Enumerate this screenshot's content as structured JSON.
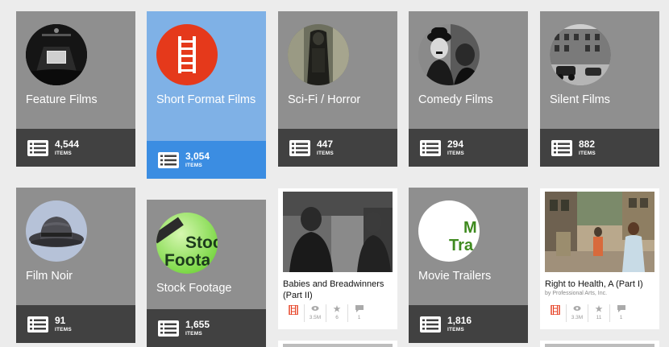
{
  "collections": [
    {
      "title": "Feature Films",
      "count": "4,544",
      "unit": "ITEMS"
    },
    {
      "title": "Short Format Films",
      "count": "3,054",
      "unit": "ITEMS"
    },
    {
      "title": "Sci-Fi / Horror",
      "count": "447",
      "unit": "ITEMS"
    },
    {
      "title": "Comedy Films",
      "count": "294",
      "unit": "ITEMS"
    },
    {
      "title": "Silent Films",
      "count": "882",
      "unit": "ITEMS"
    },
    {
      "title": "Film Noir",
      "count": "91",
      "unit": "ITEMS"
    },
    {
      "title": "Stock Footage",
      "count": "1,655",
      "unit": "ITEMS",
      "logo_top": "Stoc",
      "logo_bottom": "Foota"
    },
    {
      "title": "Movie Trailers",
      "count": "1,816",
      "unit": "ITEMS",
      "logo_top": "M",
      "logo_bottom": "Tra"
    }
  ],
  "items": [
    {
      "title": "Babies and Breadwinners (Part II)",
      "byline": "",
      "views": "3.5M",
      "favorites": "6",
      "reviews": "1"
    },
    {
      "title": "Right to Health, A (Part I)",
      "byline": "by Professional Arts, Inc.",
      "views": "3.3M",
      "favorites": "11",
      "reviews": "1"
    }
  ],
  "colors": {
    "page_bg": "#ececec",
    "card_gray": "#8f8f8f",
    "card_footer": "#414141",
    "highlight_card": "#7fb1e6",
    "highlight_footer": "#3b8de2",
    "film_icon_red": "#e5391b"
  }
}
